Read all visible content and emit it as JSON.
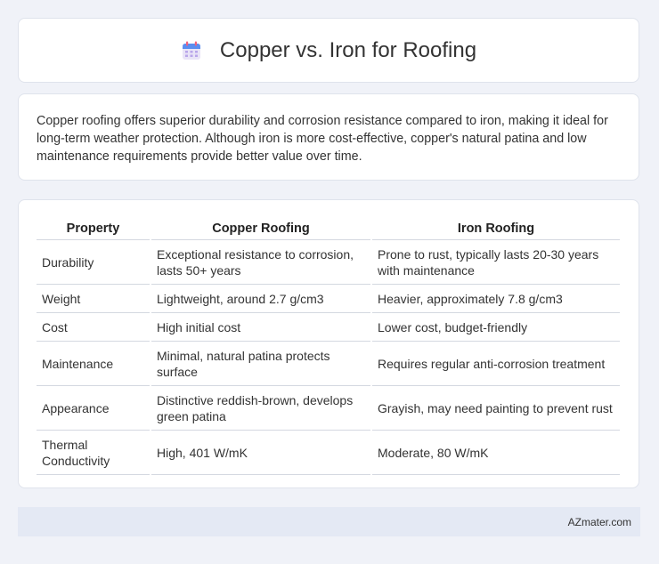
{
  "header": {
    "title": "Copper vs. Iron for Roofing",
    "icon": "calendar-icon"
  },
  "summary": "Copper roofing offers superior durability and corrosion resistance compared to iron, making it ideal for long-term weather protection. Although iron is more cost-effective, copper's natural patina and low maintenance requirements provide better value over time.",
  "table": {
    "headers": [
      "Property",
      "Copper Roofing",
      "Iron Roofing"
    ],
    "rows": [
      [
        "Durability",
        "Exceptional resistance to corrosion, lasts 50+ years",
        "Prone to rust, typically lasts 20-30 years with maintenance"
      ],
      [
        "Weight",
        "Lightweight, around 2.7 g/cm3",
        "Heavier, approximately 7.8 g/cm3"
      ],
      [
        "Cost",
        "High initial cost",
        "Lower cost, budget-friendly"
      ],
      [
        "Maintenance",
        "Minimal, natural patina protects surface",
        "Requires regular anti-corrosion treatment"
      ],
      [
        "Appearance",
        "Distinctive reddish-brown, develops green patina",
        "Grayish, may need painting to prevent rust"
      ],
      [
        "Thermal Conductivity",
        "High, 401 W/mK",
        "Moderate, 80 W/mK"
      ]
    ]
  },
  "footer": {
    "text": "AZmater.com"
  }
}
